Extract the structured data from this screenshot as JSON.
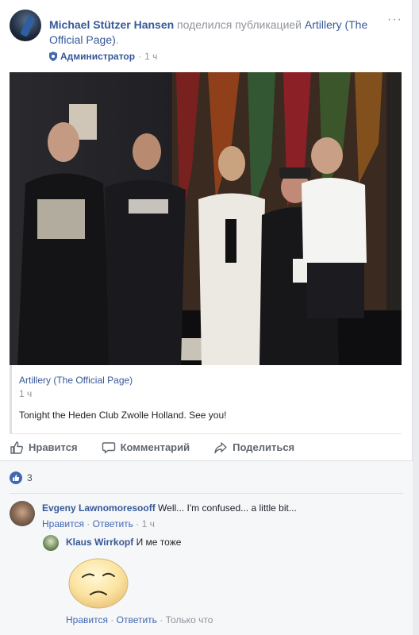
{
  "post": {
    "author": "Michael Stützer Hansen",
    "shared_text": "поделился публикацией",
    "shared_page": "Artillery (The Official Page)",
    "role": "Администратор",
    "dot": "·",
    "time": "1 ч"
  },
  "shared": {
    "page_name": "Artillery (The Official Page)",
    "time": "1 ч",
    "body": "Tonight the Heden Club Zwolle Holland. See you!"
  },
  "actions": {
    "like": "Нравится",
    "comment": "Комментарий",
    "share": "Поделиться"
  },
  "reactions": {
    "count": "3"
  },
  "comments": [
    {
      "author": "Evgeny Lawnomoresooff",
      "text": "Well... I'm confused... a little bit...",
      "like": "Нравится",
      "reply": "Ответить",
      "time": "1 ч"
    },
    {
      "author": "Klaus Wirrkopf",
      "text": "И ме тоже",
      "like": "Нравится",
      "reply": "Ответить",
      "time": "Только что"
    }
  ],
  "colors": {
    "link": "#365899",
    "muted": "#90949c",
    "like_blue": "#4267b2"
  }
}
